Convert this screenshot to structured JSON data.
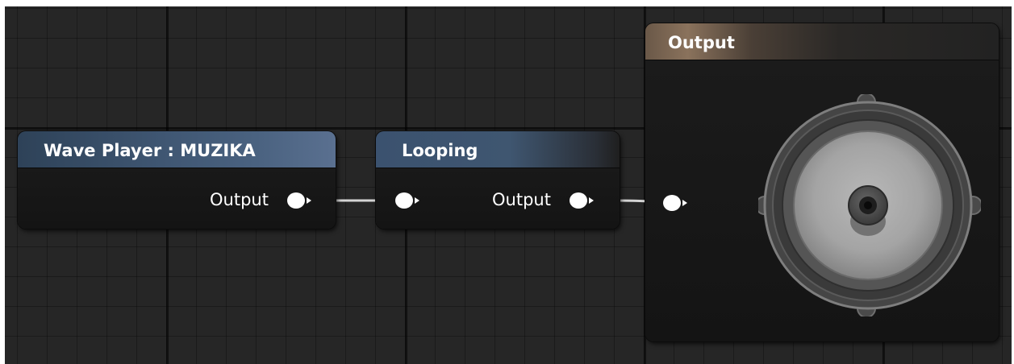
{
  "graph": {
    "nodes": [
      {
        "id": "wave-player",
        "title": "Wave Player : MUZIKA",
        "outputs": [
          "Output"
        ]
      },
      {
        "id": "looping",
        "title": "Looping",
        "inputs": [
          ""
        ],
        "outputs": [
          "Output"
        ]
      },
      {
        "id": "output",
        "title": "Output",
        "inputs": [
          ""
        ],
        "icon": "speaker-icon"
      }
    ],
    "colors": {
      "background": "#262626",
      "node_body": "#181818",
      "header_blue": "#4a6280",
      "header_brown": "#8a725c",
      "pin": "#ffffff",
      "wire": "#d0d0d0"
    }
  }
}
